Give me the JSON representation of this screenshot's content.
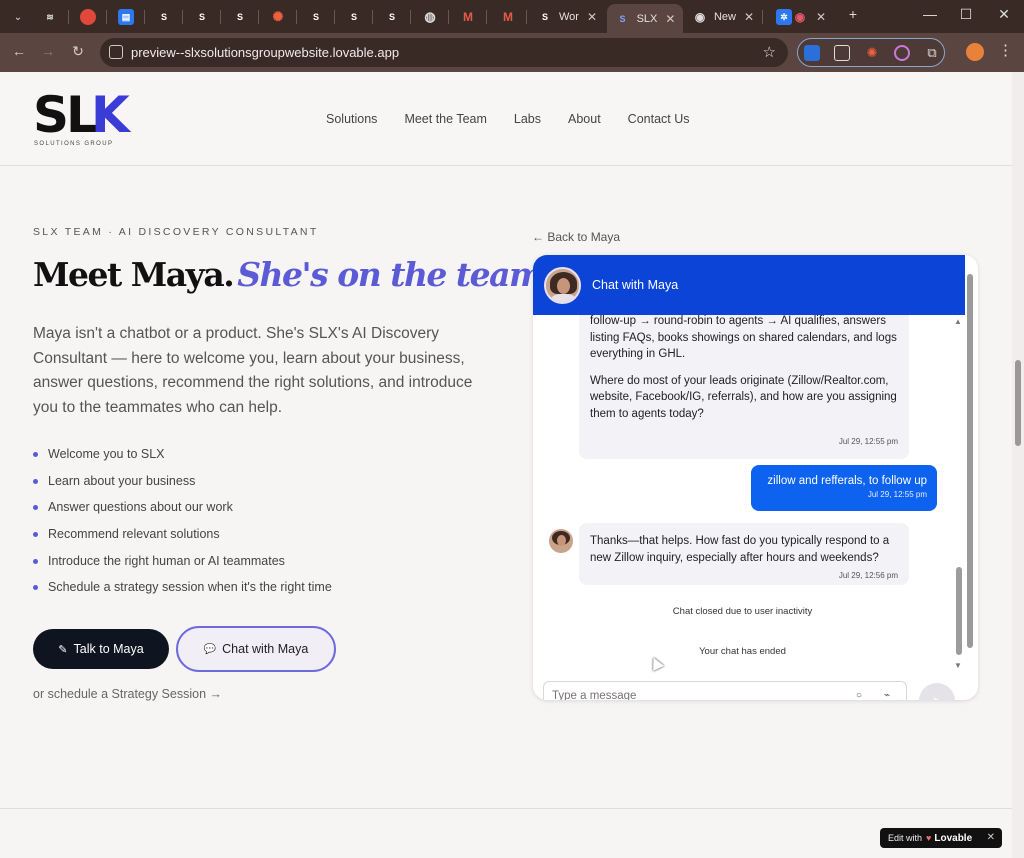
{
  "browser": {
    "tabs": [
      {
        "icon": "dropdown-icon",
        "label": "",
        "color": "#5a4540"
      },
      {
        "icon": "swirl-icon",
        "label": "",
        "color": "#444"
      },
      {
        "icon": "app-icon",
        "label": "",
        "color": "#e0483c"
      },
      {
        "icon": "doc-icon",
        "label": "",
        "color": "#2b78f0"
      },
      {
        "icon": "slx-icon",
        "label": "",
        "color": "#555"
      },
      {
        "icon": "slx-icon",
        "label": "",
        "color": "#555"
      },
      {
        "icon": "slx-icon",
        "label": "",
        "color": "#555"
      },
      {
        "icon": "burst-icon",
        "label": "",
        "color": "#e0603c"
      },
      {
        "icon": "slx-icon",
        "label": "",
        "color": "#555"
      },
      {
        "icon": "slx-icon",
        "label": "",
        "color": "#555"
      },
      {
        "icon": "slx-icon",
        "label": "",
        "color": "#555"
      },
      {
        "icon": "globe-icon",
        "label": "",
        "color": "#888"
      },
      {
        "icon": "gmail-icon",
        "label": "",
        "color": "#d94434"
      },
      {
        "icon": "gmail-icon",
        "label": "",
        "color": "#d94434"
      },
      {
        "icon": "slx-icon",
        "label": "Wor",
        "color": "#555"
      },
      {
        "icon": "slx-icon",
        "label": "SLX",
        "color": "#2b5bd0"
      },
      {
        "icon": "chrome-icon",
        "label": "New",
        "color": "#888"
      },
      {
        "icon": "settings-icon",
        "label": "",
        "color": "#2b78f0"
      }
    ],
    "new_tab_glyph": "+",
    "url": "preview--slxsolutionsgroupwebsite.lovable.app"
  },
  "site": {
    "logo_text": "SL",
    "logo_k": "K",
    "logo_tagline": "SOLUTIONS GROUP",
    "nav": [
      "Solutions",
      "Meet the Team",
      "Labs",
      "About",
      "Contact Us"
    ]
  },
  "hero": {
    "eyebrow": "SLX TEAM · AI DISCOVERY CONSULTANT",
    "headline_plain": "Meet Maya.",
    "headline_accent": "She's on the team.",
    "intro": "Maya isn't a chatbot or a product. She's SLX's AI Discovery Consultant — here to welcome you, learn about your business, answer questions, recommend the right solutions, and introduce you to the teammates who can help.",
    "bullets": [
      "Welcome you to SLX",
      "Learn about your business",
      "Answer questions about our work",
      "Recommend relevant solutions",
      "Introduce the right human or AI teammates",
      "Schedule a strategy session when it's the right time"
    ],
    "primary_cta": "Talk to Maya",
    "secondary_cta": "Chat with Maya",
    "schedule_link": "or schedule a Strategy Session →",
    "colors": {
      "accent": "#5b5bd6",
      "dark_button": "#0e1520"
    }
  },
  "chat": {
    "back_link": "← Back to Maya",
    "title": "Chat with Maya",
    "header_color": "#0d44d8",
    "messages": [
      {
        "from": "maya",
        "paragraphs": [
          "follow-up → round-robin to agents → AI qualifies, answers listing FAQs, books showings on shared calendars, and logs everything in GHL.",
          "Where do most of your leads originate (Zillow/Realtor.com, website, Facebook/IG, referrals), and how are you assigning them to agents today?"
        ],
        "time": "Jul 29, 12:55 pm"
      },
      {
        "from": "user",
        "text": "zillow and refferals, to follow up",
        "time": "Jul 29, 12:55 pm"
      },
      {
        "from": "maya",
        "paragraphs": [
          "Thanks—that helps. How fast do you typically respond to a new Zillow inquiry, especially after hours and weekends?"
        ],
        "time": "Jul 29, 12:56 pm"
      }
    ],
    "system_closed": "Chat closed due to user inactivity",
    "system_ended": "Your chat has ended",
    "input_placeholder": "Type a message",
    "user_bubble_color": "#0d63f0"
  },
  "badge": {
    "prefix": "Edit with",
    "brand": "Lovable"
  }
}
